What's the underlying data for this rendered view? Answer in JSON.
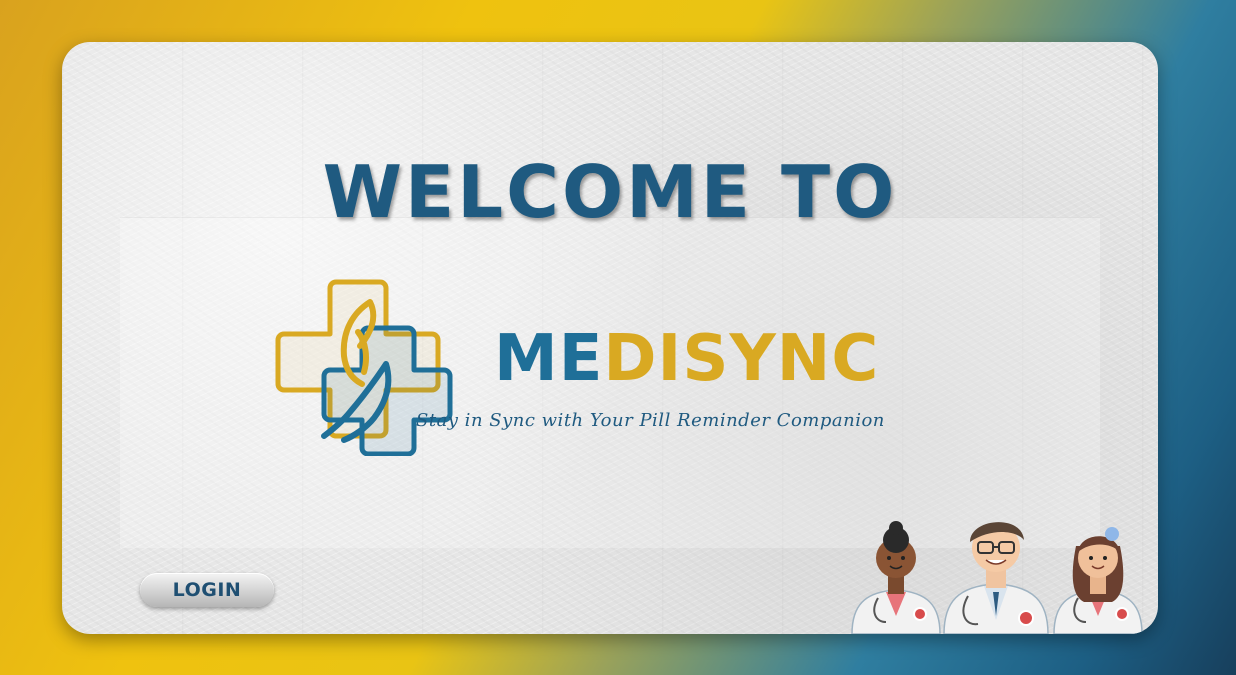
{
  "welcome": {
    "heading": "WELCOME TO"
  },
  "brand": {
    "part1": "ME",
    "part2": "DISY",
    "part3": "NC",
    "tagline": "Stay in Sync with  Your Pill Reminder Companion"
  },
  "login": {
    "label": "LOGIN"
  },
  "colors": {
    "primary_blue": "#1f5a80",
    "brand_blue": "#1f6f98",
    "brand_gold": "#d9a922"
  },
  "icons": {
    "logo": "medical-cross-hands-icon",
    "illustration": "doctors-illustration"
  }
}
